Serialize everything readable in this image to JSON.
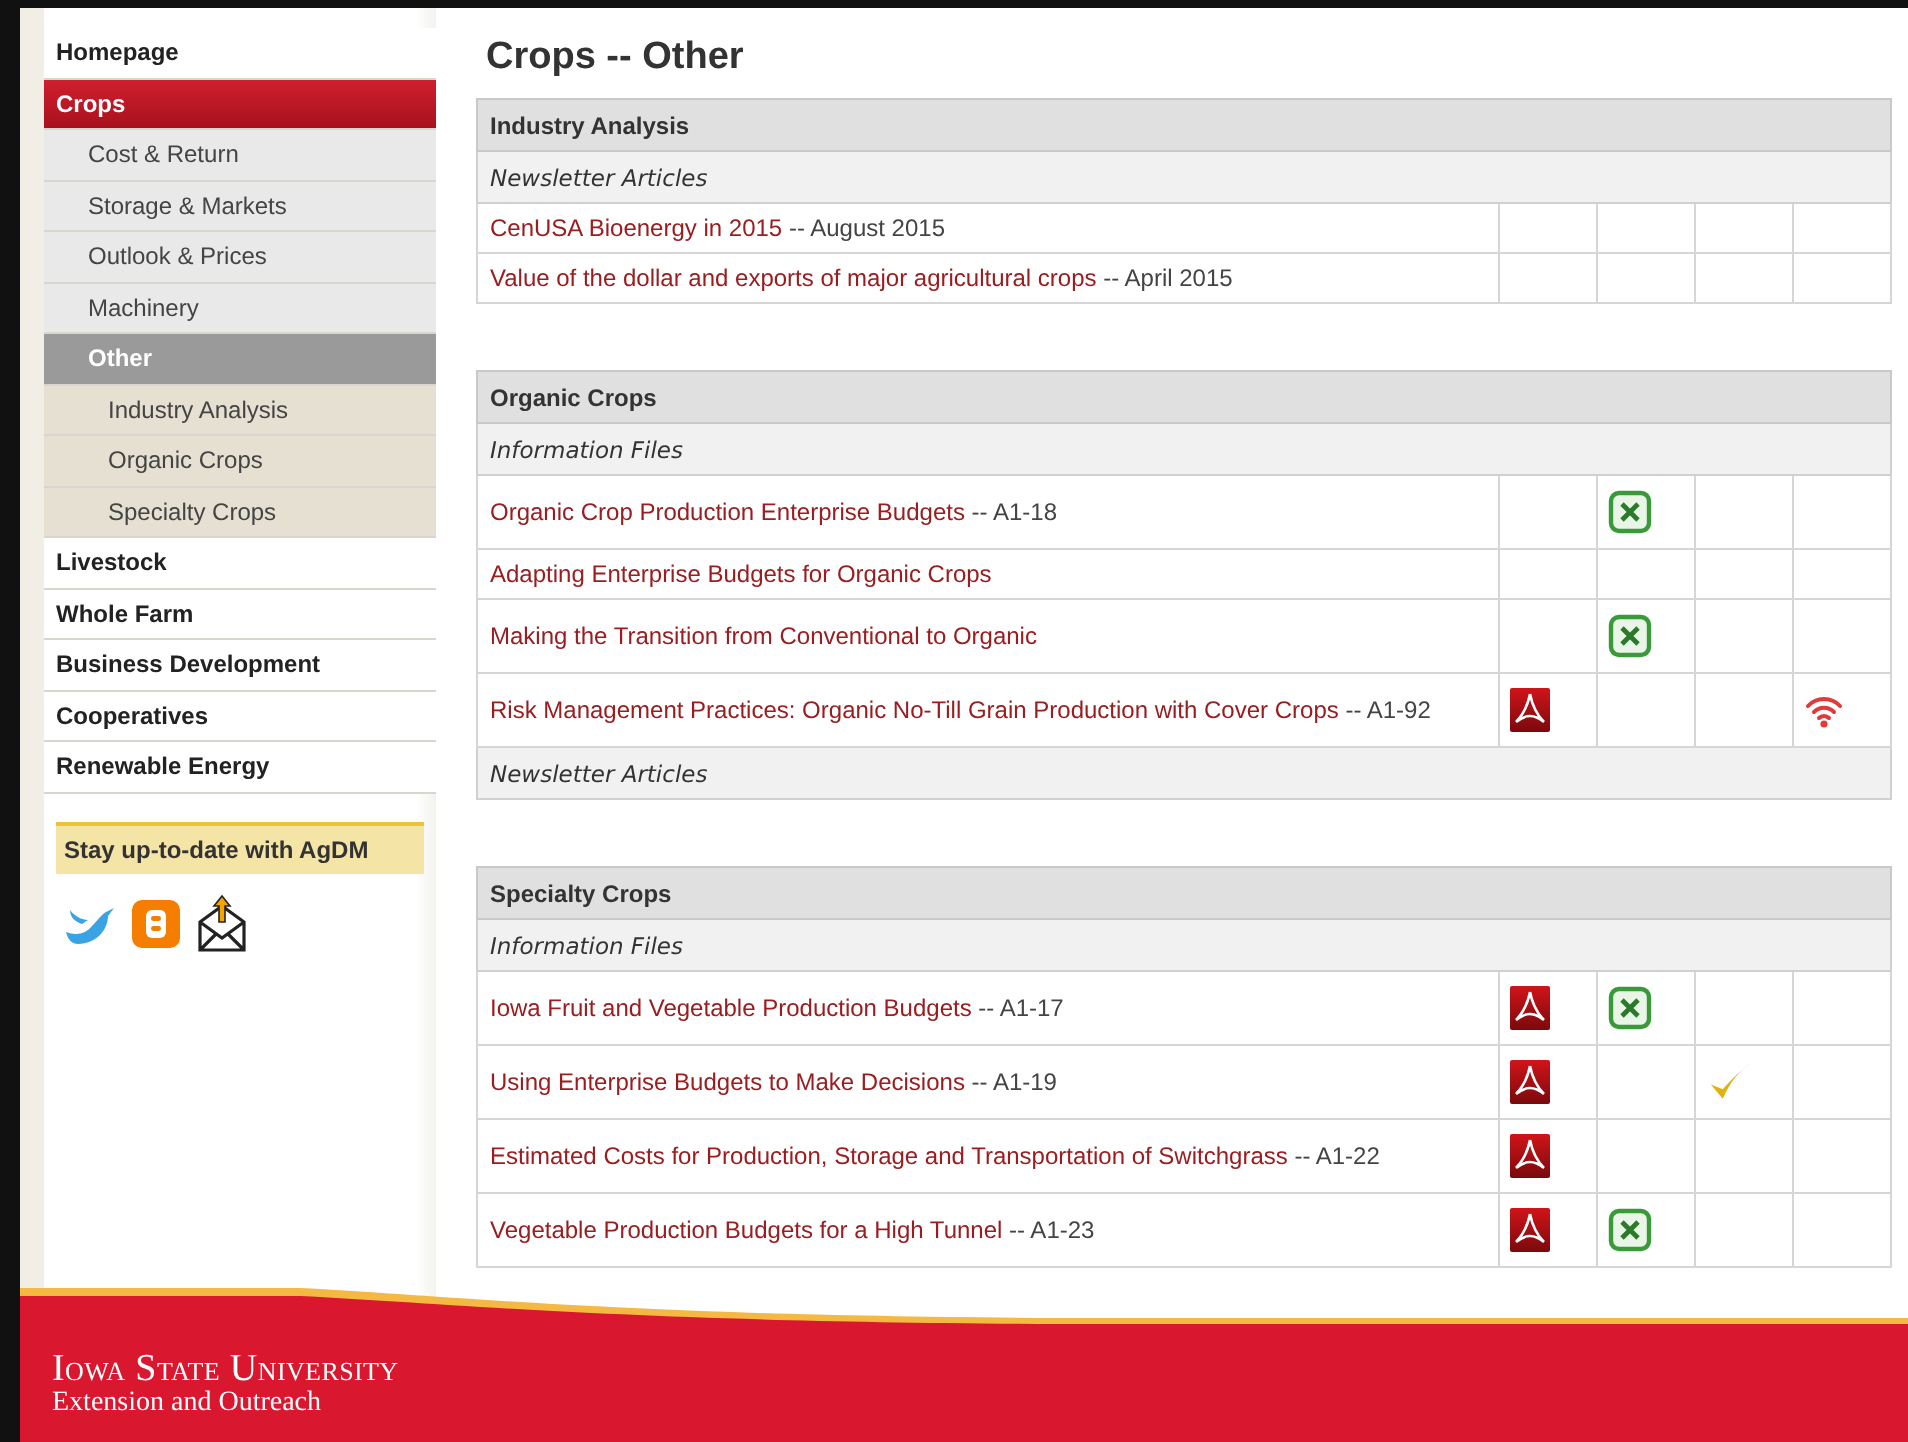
{
  "sidebar": {
    "items": [
      {
        "label": "Homepage",
        "selected": false
      },
      {
        "label": "Crops",
        "selected": true,
        "children": [
          {
            "label": "Cost & Return",
            "selected": false
          },
          {
            "label": "Storage & Markets",
            "selected": false
          },
          {
            "label": "Outlook & Prices",
            "selected": false
          },
          {
            "label": "Machinery",
            "selected": false
          },
          {
            "label": "Other",
            "selected": true,
            "children": [
              {
                "label": "Industry Analysis",
                "selected": false
              },
              {
                "label": "Organic Crops",
                "selected": false
              },
              {
                "label": "Specialty Crops",
                "selected": false
              }
            ]
          }
        ]
      },
      {
        "label": "Livestock",
        "selected": false
      },
      {
        "label": "Whole Farm",
        "selected": false
      },
      {
        "label": "Business Development",
        "selected": false
      },
      {
        "label": "Cooperatives",
        "selected": false
      },
      {
        "label": "Renewable Energy",
        "selected": false
      }
    ],
    "promo": "Stay up-to-date with AgDM",
    "social": [
      {
        "kind": "bird"
      },
      {
        "kind": "blog"
      },
      {
        "kind": "mail"
      }
    ]
  },
  "page_title": "Crops -- Other",
  "sections": [
    {
      "title": "Industry Analysis",
      "groups": [
        {
          "title": "Newsletter Articles",
          "rows": [
            {
              "link": "CenUSA Bioenergy in 2015",
              "suffix": "-- August 2015",
              "cells": [
                {
                  "kind": "blank"
                },
                {
                  "kind": "blank"
                },
                {
                  "kind": "blank"
                },
                {
                  "kind": "blank"
                }
              ]
            },
            {
              "link": "Value of the dollar and exports of major agricultural crops",
              "suffix": "-- April 2015",
              "cells": [
                {
                  "kind": "blank"
                },
                {
                  "kind": "blank"
                },
                {
                  "kind": "blank"
                },
                {
                  "kind": "blank"
                }
              ]
            }
          ]
        }
      ]
    },
    {
      "title": "Organic Crops",
      "groups": [
        {
          "title": "Information Files",
          "rows": [
            {
              "link": "Organic Crop Production Enterprise Budgets",
              "suffix": "-- A1-18",
              "cells": [
                {
                  "kind": "blank"
                },
                {
                  "kind": "excel"
                },
                {
                  "kind": "blank"
                },
                {
                  "kind": "blank"
                }
              ]
            },
            {
              "link": "Adapting Enterprise Budgets for Organic Crops",
              "cells": [
                {
                  "kind": "blank"
                },
                {
                  "kind": "blank"
                },
                {
                  "kind": "blank"
                },
                {
                  "kind": "blank"
                }
              ]
            },
            {
              "link": "Making the Transition from Conventional to Organic",
              "cells": [
                {
                  "kind": "blank"
                },
                {
                  "kind": "excel"
                },
                {
                  "kind": "blank"
                },
                {
                  "kind": "blank"
                }
              ]
            },
            {
              "link": "Risk Management Practices: Organic No-Till Grain Production with Cover Crops",
              "suffix": "-- A1-92",
              "cells": [
                {
                  "kind": "pdf"
                },
                {
                  "kind": "blank"
                },
                {
                  "kind": "blank"
                },
                {
                  "kind": "wifi"
                }
              ]
            }
          ]
        },
        {
          "title": "Newsletter Articles"
        }
      ]
    },
    {
      "title": "Specialty Crops",
      "groups": [
        {
          "title": "Information Files",
          "rows": [
            {
              "link": "Iowa Fruit and Vegetable Production Budgets",
              "suffix": "-- A1-17",
              "cells": [
                {
                  "kind": "pdf"
                },
                {
                  "kind": "excel"
                },
                {
                  "kind": "blank"
                },
                {
                  "kind": "blank"
                }
              ]
            },
            {
              "link": "Using Enterprise Budgets to Make Decisions",
              "suffix": "-- A1-19",
              "cells": [
                {
                  "kind": "pdf"
                },
                {
                  "kind": "blank"
                },
                {
                  "kind": "check"
                },
                {
                  "kind": "blank"
                }
              ]
            },
            {
              "link": "Estimated Costs for Production, Storage and Transportation of Switchgrass",
              "suffix": "-- A1-22",
              "cells": [
                {
                  "kind": "pdf"
                },
                {
                  "kind": "blank"
                },
                {
                  "kind": "blank"
                },
                {
                  "kind": "blank"
                }
              ]
            },
            {
              "link": "Vegetable Production Budgets for a High Tunnel",
              "suffix": "-- A1-23",
              "cells": [
                {
                  "kind": "pdf"
                },
                {
                  "kind": "excel"
                },
                {
                  "kind": "blank"
                },
                {
                  "kind": "blank"
                }
              ]
            }
          ]
        }
      ]
    }
  ],
  "footer": {
    "name": "Iowa State University",
    "unit": "Extension and Outreach"
  }
}
